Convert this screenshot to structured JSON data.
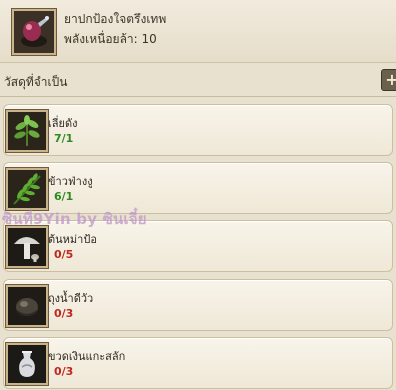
{
  "header": {
    "title": "ยาปกป้องใจตรึงเทพ",
    "subtitle": "พลังเหนื่อยล้า: 10",
    "icon": "medicine-item-icon"
  },
  "section": {
    "label": "วัสดุที่จำเป็น",
    "expand_symbol": "+"
  },
  "materials": [
    {
      "name": "เลี่ยดัง",
      "qty": "7/1",
      "icon": "herb-sprig-icon",
      "status_color": "#2e8a1f"
    },
    {
      "name": "ข้าวฟ่างงู",
      "qty": "6/1",
      "icon": "fern-leaf-icon",
      "status_color": "#2e8a1f"
    },
    {
      "name": "ต้นหม่าป้อ",
      "qty": "0/5",
      "icon": "mushroom-icon",
      "status_color": "#c0271d"
    },
    {
      "name": "ถุงน้ำดีวัว",
      "qty": "0/3",
      "icon": "gallbladder-icon",
      "status_color": "#c0271d"
    },
    {
      "name": "ขวดเงินแกะสลัก",
      "qty": "0/3",
      "icon": "silver-vase-icon",
      "status_color": "#c0271d"
    }
  ],
  "watermark": "ซินที่9Yin by ซินเจี๋ย"
}
